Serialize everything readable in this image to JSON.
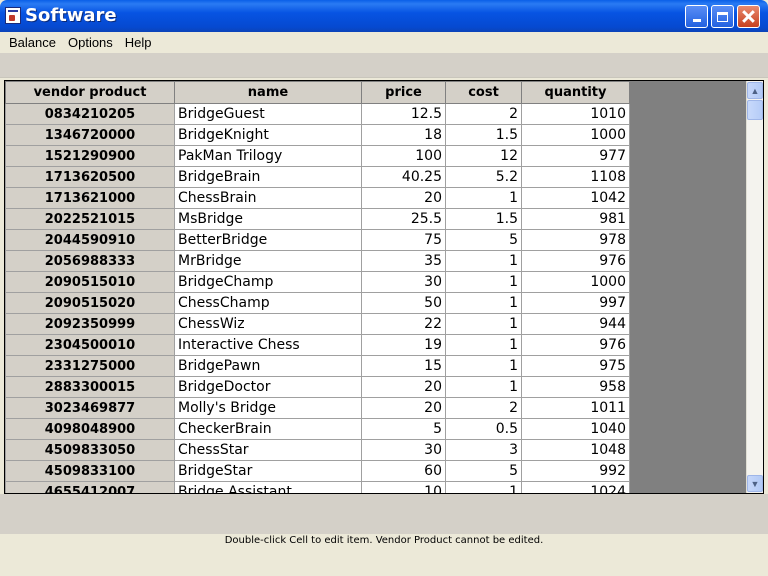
{
  "window": {
    "title": "Software",
    "icon": "app-document-icon"
  },
  "menu": {
    "items": [
      "Balance",
      "Options",
      "Help"
    ]
  },
  "table": {
    "columns": [
      "vendor product",
      "name",
      "price",
      "cost",
      "quantity"
    ],
    "rows": [
      [
        "0834210205",
        "BridgeGuest",
        "12.5",
        "2",
        "1010"
      ],
      [
        "1346720000",
        "BridgeKnight",
        "18",
        "1.5",
        "1000"
      ],
      [
        "1521290900",
        "PakMan Trilogy",
        "100",
        "12",
        "977"
      ],
      [
        "1713620500",
        "BridgeBrain",
        "40.25",
        "5.2",
        "1108"
      ],
      [
        "1713621000",
        "ChessBrain",
        "20",
        "1",
        "1042"
      ],
      [
        "2022521015",
        "MsBridge",
        "25.5",
        "1.5",
        "981"
      ],
      [
        "2044590910",
        "BetterBridge",
        "75",
        "5",
        "978"
      ],
      [
        "2056988333",
        "MrBridge",
        "35",
        "1",
        "976"
      ],
      [
        "2090515010",
        "BridgeChamp",
        "30",
        "1",
        "1000"
      ],
      [
        "2090515020",
        "ChessChamp",
        "50",
        "1",
        "997"
      ],
      [
        "2092350999",
        "ChessWiz",
        "22",
        "1",
        "944"
      ],
      [
        "2304500010",
        "Interactive Chess",
        "19",
        "1",
        "976"
      ],
      [
        "2331275000",
        "BridgePawn",
        "15",
        "1",
        "975"
      ],
      [
        "2883300015",
        "BridgeDoctor",
        "20",
        "1",
        "958"
      ],
      [
        "3023469877",
        "Molly's Bridge",
        "20",
        "2",
        "1011"
      ],
      [
        "4098048900",
        "CheckerBrain",
        "5",
        "0.5",
        "1040"
      ],
      [
        "4509833050",
        "ChessStar",
        "30",
        "3",
        "1048"
      ],
      [
        "4509833100",
        "BridgeStar",
        "60",
        "5",
        "992"
      ],
      [
        "4655412007",
        "Bridge Assistant",
        "10",
        "1",
        "1024"
      ]
    ]
  },
  "status": {
    "text": "Double-click Cell to edit item. Vendor Product cannot be edited."
  }
}
